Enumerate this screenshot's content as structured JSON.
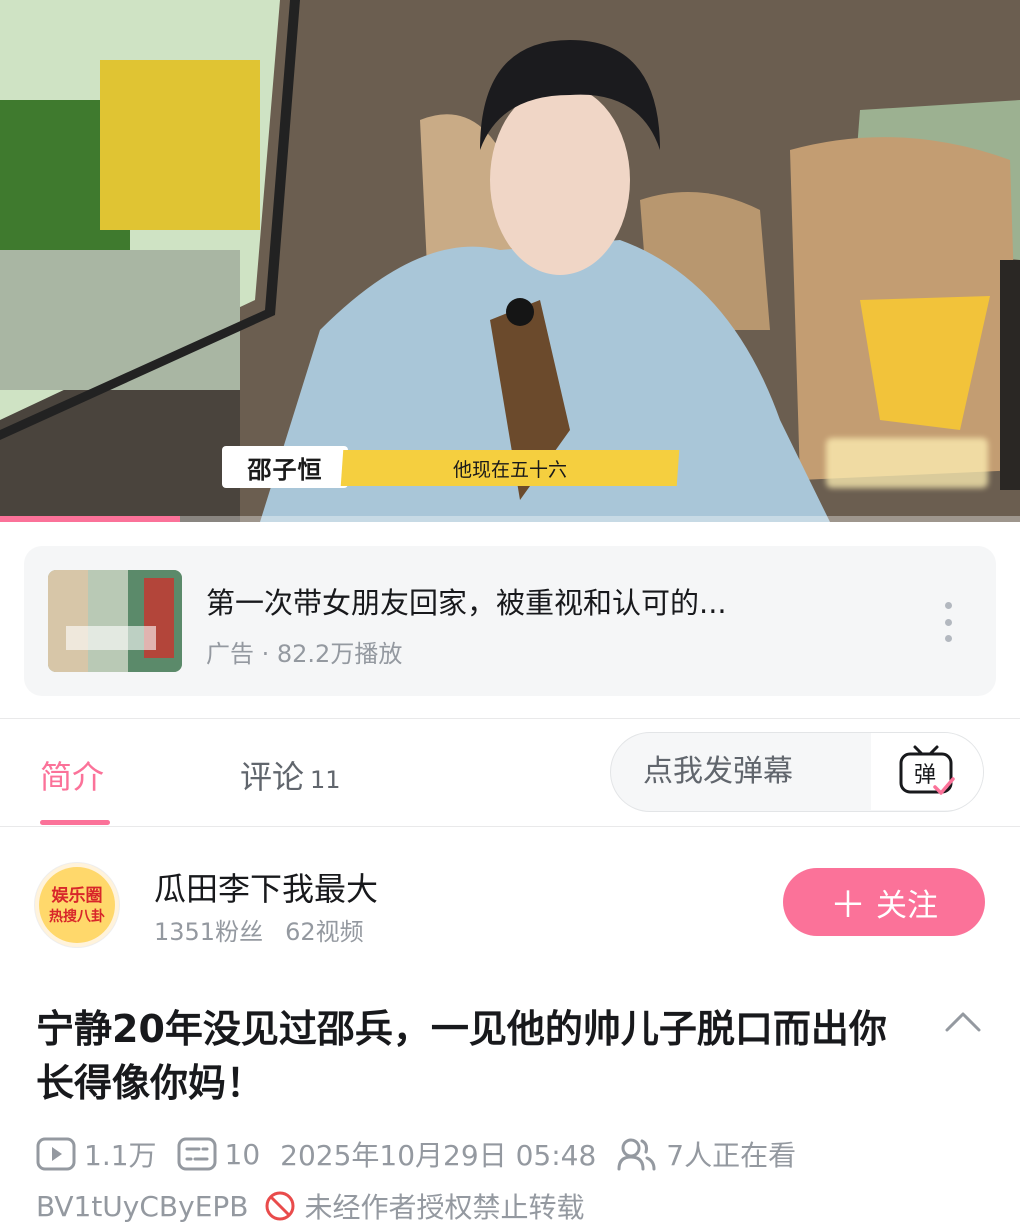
{
  "player": {
    "subtitle_name": "邵子恒",
    "subtitle_text": "他现在五十六",
    "progress_fraction": 0.176
  },
  "ad": {
    "title": "第一次带女朋友回家，被重视和认可的...",
    "meta": "广告 · 82.2万播放"
  },
  "tabs": {
    "intro_label": "简介",
    "comments_label": "评论",
    "comments_count": "11",
    "danmaku_placeholder": "点我发弹幕",
    "danmaku_icon_text": "弹"
  },
  "uploader": {
    "name": "瓜田李下我最大",
    "followers": "1351粉丝",
    "videos": "62视频",
    "avatar_line1": "娱乐圈",
    "avatar_line2": "热搜八卦",
    "follow_label": "关注"
  },
  "video": {
    "title": "宁静20年没见过邵兵，一见他的帅儿子脱口而出你长得像你妈！",
    "plays": "1.1万",
    "danmaku_count": "10",
    "date": "2025年10月29日 05:48",
    "watching": "7人正在看",
    "bvid": "BV1tUyCByEPB",
    "copyright_notice": "未经作者授权禁止转载"
  },
  "colors": {
    "accent": "#fb7299",
    "muted": "#9499a0",
    "text": "#18191c"
  },
  "icons": [
    "play-count-icon",
    "danmaku-count-icon",
    "watching-icon",
    "no-repost-icon",
    "collapse-chevron-icon",
    "more-vertical-icon",
    "danmaku-send-icon",
    "plus-icon"
  ]
}
